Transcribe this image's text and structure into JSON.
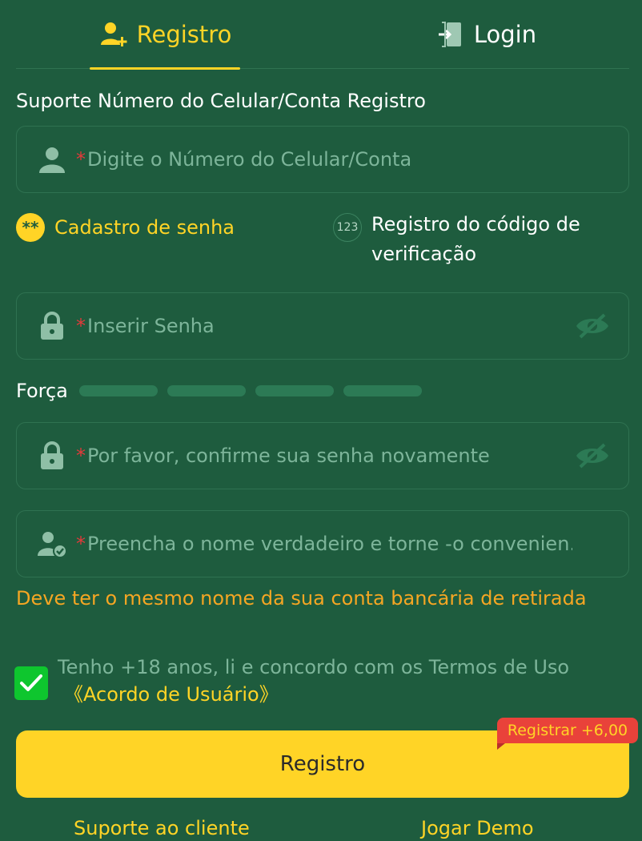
{
  "tabs": {
    "register_label": "Registro",
    "login_label": "Login"
  },
  "form": {
    "section_label": "Suporte Número do Celular/Conta Registro",
    "account_placeholder": "Digite o Número do Celular/Conta",
    "required_mark": "*",
    "mode_password_badge": "**",
    "mode_password_label": "Cadastro de senha",
    "mode_code_badge": "123",
    "mode_code_label_line1": "Registro do código de",
    "mode_code_label_line2": "verificação",
    "password_placeholder": "Inserir Senha",
    "strength_label": "Força",
    "confirm_placeholder": "Por favor, confirme sua senha novamente",
    "realname_placeholder": "Preencha o nome verdadeiro e torne -o convenien...",
    "realname_note": "Deve ter o mesmo nome da sua conta bancária de retirada"
  },
  "agreement": {
    "checked": true,
    "text": "Tenho +18 anos, li e concordo com os Termos de Uso",
    "link_label": "《Acordo de Usuário》"
  },
  "submit": {
    "label": "Registro",
    "bonus_tag": "Registrar +6,00"
  },
  "footer": {
    "support_label": "Suporte ao cliente",
    "demo_label": "Jogar Demo"
  },
  "colors": {
    "background": "#1e5c3e",
    "accent": "#ffd426",
    "warning": "#f5a623",
    "required": "#e23a3a",
    "checkbox": "#0ec62e",
    "bonus": "#e9423a"
  }
}
